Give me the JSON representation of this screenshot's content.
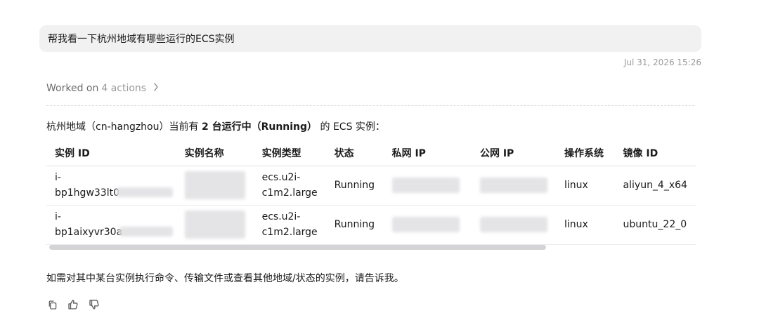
{
  "user_message": "帮我看一下杭州地域有哪些运行的ECS实例",
  "timestamp": "Jul 31, 2026 15:26",
  "worked_on": {
    "prefix": "Worked on",
    "count": "4 actions"
  },
  "intro": {
    "pre": "杭州地域（cn-hangzhou）当前有 ",
    "bold": "2 台运行中（Running）",
    "post": " 的 ECS 实例："
  },
  "table": {
    "headers": [
      "实例 ID",
      "实例名称",
      "实例类型",
      "状态",
      "私网 IP",
      "公网 IP",
      "操作系统",
      "镜像 ID"
    ],
    "rows": [
      {
        "id_line1": "i-",
        "id_line2": "bp1hgw33lt0",
        "type_line1": "ecs.u2i-",
        "type_line2": "c1m2.large",
        "status": "Running",
        "os": "linux",
        "image": "aliyun_4_x64"
      },
      {
        "id_line1": "i-",
        "id_line2": "bp1aixyvr30a",
        "type_line1": "ecs.u2i-",
        "type_line2": "c1m2.large",
        "status": "Running",
        "os": "linux",
        "image": "ubuntu_22_0"
      }
    ]
  },
  "table_scroll": {
    "visible_fraction": 0.77
  },
  "outro": "如需对其中某台实例执行命令、传输文件或查看其他地域/状态的实例，请告诉我。",
  "actions": [
    "copy-icon",
    "thumbs-up-icon",
    "thumbs-down-icon"
  ]
}
